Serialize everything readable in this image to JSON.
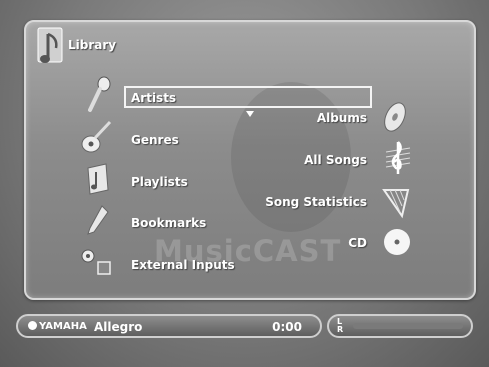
{
  "header": {
    "title": "Library"
  },
  "menu": {
    "left_items": [
      {
        "label": "Artists",
        "icon": "microphone-icon",
        "selected": true
      },
      {
        "label": "Genres",
        "icon": "guitar-icon"
      },
      {
        "label": "Playlists",
        "icon": "music-note-page-icon"
      },
      {
        "label": "Bookmarks",
        "icon": "bookmark-pen-icon"
      },
      {
        "label": "External Inputs",
        "icon": "external-input-icon"
      }
    ],
    "right_items": [
      {
        "label": "Albums",
        "icon": "disc-icon"
      },
      {
        "label": "All Songs",
        "icon": "treble-clef-icon"
      },
      {
        "label": "Song Statistics",
        "icon": "harp-icon"
      },
      {
        "label": "CD",
        "icon": "cd-icon"
      }
    ]
  },
  "watermark": "MusicCAST",
  "status": {
    "brand": "YAMAHA",
    "track": "Allegro",
    "time": "0:00"
  },
  "level": {
    "left_channel": "L",
    "right_channel": "R"
  },
  "colors": {
    "text": "#ffffff",
    "panel": "#8c8c8c",
    "border": "#d8d8d8"
  }
}
